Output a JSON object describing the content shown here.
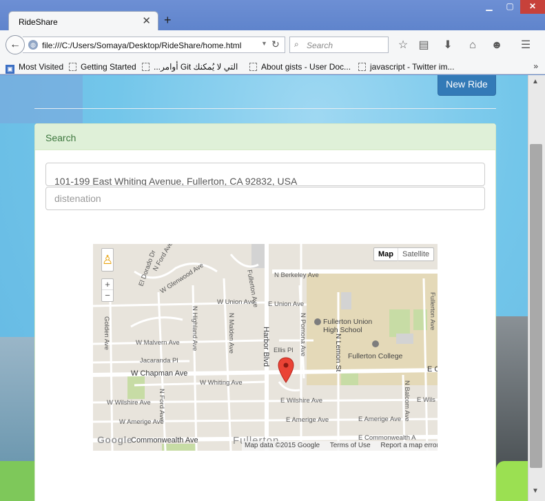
{
  "browser": {
    "tab_title": "RideShare",
    "url": "file:///C:/Users/Somaya/Desktop/RideShare/home.html",
    "search_placeholder": "Search",
    "bookmarks": [
      "Most Visited",
      "Getting Started",
      "...أوامر Git التي لا يُمكنك",
      "About gists - User Doc...",
      "javascript - Twitter im..."
    ]
  },
  "page": {
    "new_ride_label": "New Ride",
    "panel_heading": "Search",
    "origin_value": "101-199 East Whiting Avenue, Fullerton, CA 92832, USA",
    "destination_placeholder": "distenation"
  },
  "map": {
    "type_map": "Map",
    "type_satellite": "Satellite",
    "google": "Google",
    "attribution_data": "Map data ©2015 Google",
    "attribution_terms": "Terms of Use",
    "attribution_report": "Report a map error",
    "labels": {
      "berkeley": "N Berkeley Ave",
      "union_w": "W Union Ave",
      "union_e": "E Union Ave",
      "glenwood": "W Glenwood Ave",
      "malvern": "W Malvern Ave",
      "jacaranda": "Jacaranda Pl",
      "chapman": "W Chapman Ave",
      "chapman_e": "E Ch",
      "whiting": "W Whiting Ave",
      "wilshire_w": "W Wilshire Ave",
      "wilshire_e": "E Wilshire Ave",
      "wilshire_e2": "E Wils",
      "amerige_w": "W Amerige Ave",
      "amerige_e": "E Amerige Ave",
      "amerige_e2": "E Amerige Ave",
      "commonwealth_w": "Commonwealth Ave",
      "commonwealth_e": "E Commonwealth A",
      "harbor": "Harbor Blvd",
      "pomona": "N Pomona Ave",
      "lemon": "N Lemon St",
      "balcom": "N Balcom Ave",
      "highland": "N Highland Ave",
      "malden": "N Malden Ave",
      "ford_n": "N Ford Ave",
      "ford": "N Ford Ave",
      "eldorado": "El Dorado Dr",
      "golden": "Golden Ave",
      "ellis": "Ellis Pl",
      "fullerton_union": "Fullerton Union",
      "high_school": "High School",
      "fullerton_college": "Fullerton College",
      "fullerton": "Fullerton",
      "fullerton_ave": "Fullerton Ave"
    }
  }
}
